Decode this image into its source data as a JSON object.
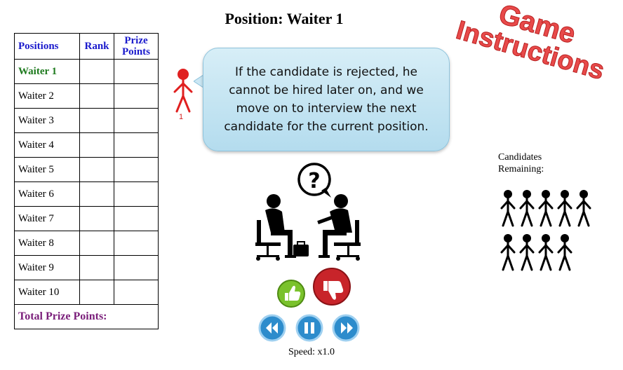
{
  "header": {
    "title": "Position: Waiter 1"
  },
  "table": {
    "headers": {
      "positions": "Positions",
      "rank": "Rank",
      "prize_points": "Prize Points"
    },
    "rows": [
      {
        "position": "Waiter 1",
        "rank": "",
        "prize": ""
      },
      {
        "position": "Waiter 2",
        "rank": "",
        "prize": ""
      },
      {
        "position": "Waiter 3",
        "rank": "",
        "prize": ""
      },
      {
        "position": "Waiter 4",
        "rank": "",
        "prize": ""
      },
      {
        "position": "Waiter 5",
        "rank": "",
        "prize": ""
      },
      {
        "position": "Waiter 6",
        "rank": "",
        "prize": ""
      },
      {
        "position": "Waiter 7",
        "rank": "",
        "prize": ""
      },
      {
        "position": "Waiter 8",
        "rank": "",
        "prize": ""
      },
      {
        "position": "Waiter 9",
        "rank": "",
        "prize": ""
      },
      {
        "position": "Waiter 10",
        "rank": "",
        "prize": ""
      }
    ],
    "total_label": "Total Prize Points:"
  },
  "current_candidate": {
    "number": "1",
    "color": "#e02020"
  },
  "instruction": {
    "text": "If the candidate is rejected, he cannot be hired later on, and we move on to interview the next candidate for the current position."
  },
  "logo": {
    "line1": "Game",
    "line2": "Instructions",
    "color": "#e03a3a"
  },
  "remaining": {
    "label": "Candidates Remaining:",
    "count": 9
  },
  "scene": {
    "question_mark": "?"
  },
  "controls": {
    "accept_icon": "thumbs-up-icon",
    "reject_icon": "thumbs-down-icon",
    "rewind_icon": "rewind-icon",
    "pause_icon": "pause-icon",
    "forward_icon": "fast-forward-icon"
  },
  "speed": {
    "label": "Speed: x1.0"
  },
  "colors": {
    "header_blue": "#1a1acc",
    "current_green": "#1e7a1e",
    "total_purple": "#7a1e7a",
    "accept_green": "#7ac22c",
    "reject_red": "#c8242a",
    "playback_blue": "#2d8ccc"
  }
}
